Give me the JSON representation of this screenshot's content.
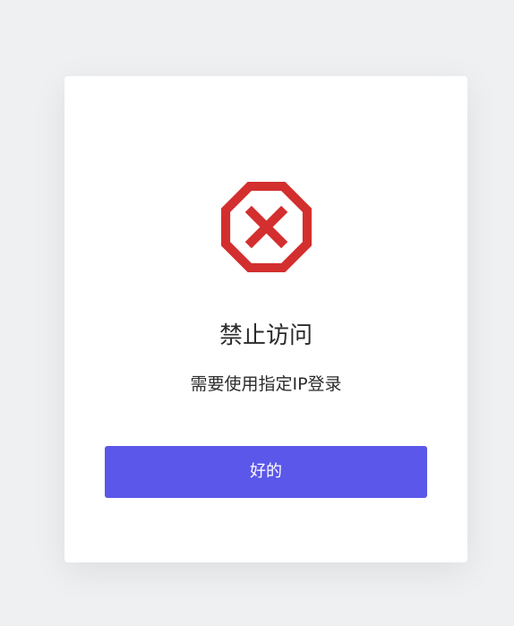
{
  "dialog": {
    "icon": "stop-x-icon",
    "title": "禁止访问",
    "message": "需要使用指定IP登录",
    "ok_label": "好的"
  },
  "colors": {
    "background": "#eff0f2",
    "card": "#ffffff",
    "icon": "#d32f2f",
    "button": "#5b57ea",
    "text": "#2b2b2b"
  }
}
